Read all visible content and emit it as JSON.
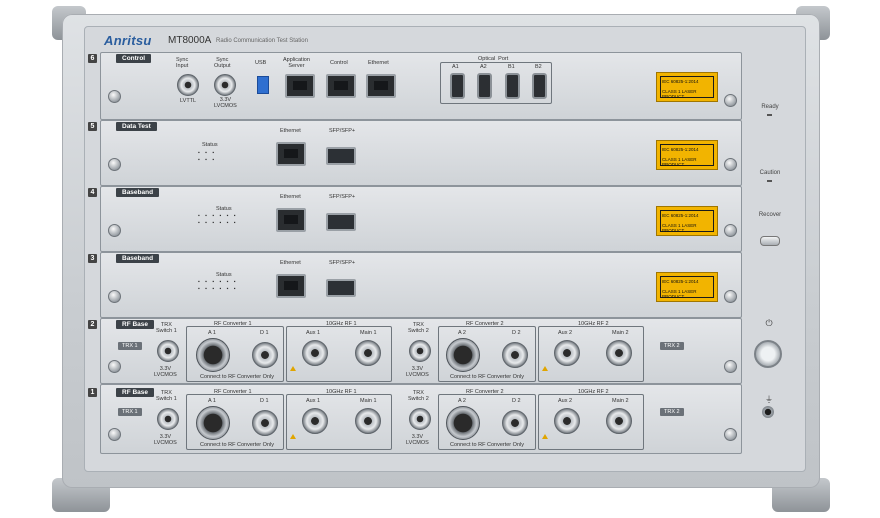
{
  "brand": {
    "logo": "Anritsu",
    "model": "MT8000A",
    "subtitle": "Radio Communication Test Station"
  },
  "modules": [
    {
      "slot": "6",
      "label": "Control",
      "ports": {
        "sync_input": "Sync\nInput",
        "sync_output": "Sync\nOutput",
        "usb": "USB",
        "app_server": "Application\nServer",
        "control": "Control",
        "ethernet": "Ethernet",
        "optical_port": "Optical  Port",
        "optical": [
          "A1",
          "A2",
          "B1",
          "B2"
        ],
        "lvttl": "LVTTL",
        "lvcmos": "3.3V\nLVCMOS"
      },
      "laser": [
        "IEC 60825-1:2014",
        "CLASS 1 LASER PRODUCT"
      ]
    },
    {
      "slot": "5",
      "label": "Data Test",
      "status": "Status",
      "ethernet": "Ethernet",
      "sfp": "SFP/SFP+",
      "laser": [
        "IEC 60825-1:2014",
        "CLASS 1 LASER PRODUCT"
      ]
    },
    {
      "slot": "4",
      "label": "Baseband",
      "status": "Status",
      "ethernet": "Ethernet",
      "sfp": "SFP/SFP+",
      "laser": [
        "IEC 60825-1:2014",
        "CLASS 1 LASER PRODUCT"
      ]
    },
    {
      "slot": "3",
      "label": "Baseband",
      "status": "Status",
      "ethernet": "Ethernet",
      "sfp": "SFP/SFP+",
      "laser": [
        "IEC 60825-1:2014",
        "CLASS 1 LASER PRODUCT"
      ]
    },
    {
      "slot": "2",
      "label": "RF Base",
      "trx_left": "TRX 1",
      "trx_right": "TRX 2",
      "sw1": "TRX\nSwitch 1",
      "sw2": "TRX\nSwitch 2",
      "rfc1": "RF Converter 1",
      "rfc2": "RF Converter 2",
      "a1": "A 1",
      "d1": "D 1",
      "a2": "A 2",
      "d2": "D 2",
      "rf1": "10GHz RF 1",
      "rf2": "10GHz RF 2",
      "aux1": "Aux 1",
      "main1": "Main 1",
      "aux2": "Aux 2",
      "main2": "Main 2",
      "connect_only": "Connect to RF Converter Only",
      "lvcmos": "3.3V\nLVCMOS"
    },
    {
      "slot": "1",
      "label": "RF Base",
      "trx_left": "TRX 1",
      "trx_right": "TRX 2",
      "sw1": "TRX\nSwitch 1",
      "sw2": "TRX\nSwitch 2",
      "rfc1": "RF Converter 1",
      "rfc2": "RF Converter 2",
      "a1": "A 1",
      "d1": "D 1",
      "a2": "A 2",
      "d2": "D 2",
      "rf1": "10GHz RF 1",
      "rf2": "10GHz RF 2",
      "aux1": "Aux 1",
      "main1": "Main 1",
      "aux2": "Aux 2",
      "main2": "Main 2",
      "connect_only": "Connect to RF Converter Only",
      "lvcmos": "3.3V\nLVCMOS"
    }
  ],
  "side": {
    "ready": "Ready",
    "caution": "Caution",
    "recover": "Recover"
  },
  "colors": {
    "brand": "#2a5d9e",
    "laser_label": "#f2b400",
    "usb": "#2f6fd0"
  }
}
